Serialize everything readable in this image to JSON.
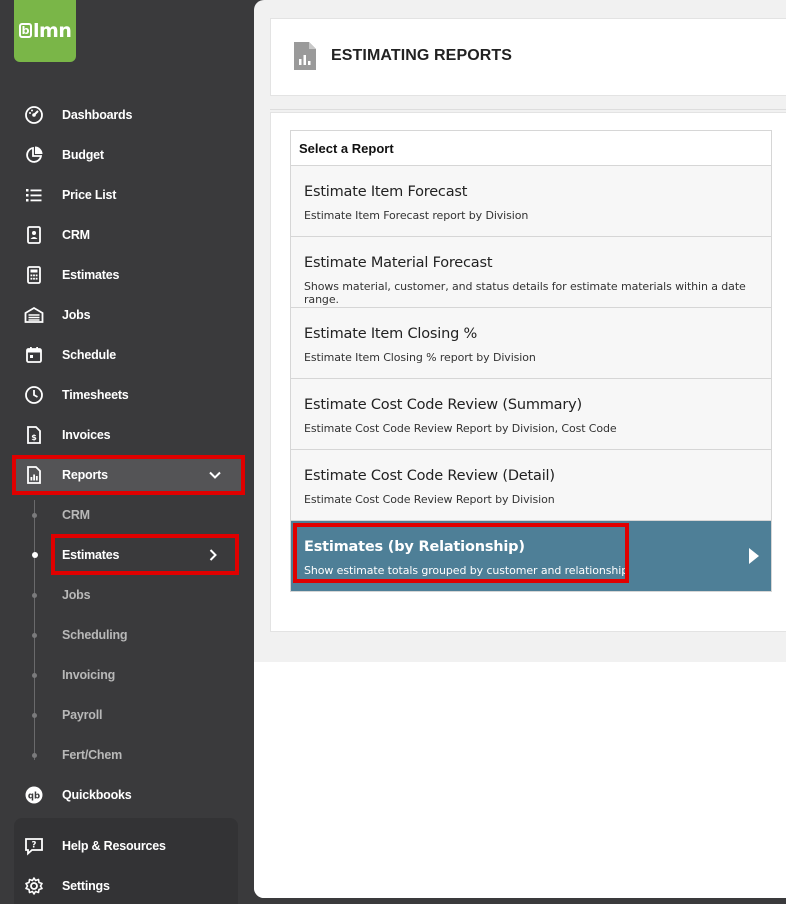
{
  "app": {
    "logo_text": "lmn",
    "logo_letter": "b"
  },
  "colors": {
    "brand": "#7ab648",
    "sidebar": "#3a3a3c",
    "active_row": "#4e7f97",
    "highlight": "#e00000"
  },
  "sidebar": {
    "items": [
      {
        "label": "Dashboards",
        "icon": "dashboard-icon"
      },
      {
        "label": "Budget",
        "icon": "pie-chart-icon"
      },
      {
        "label": "Price List",
        "icon": "list-icon"
      },
      {
        "label": "CRM",
        "icon": "contact-card-icon"
      },
      {
        "label": "Estimates",
        "icon": "calculator-icon"
      },
      {
        "label": "Jobs",
        "icon": "garage-icon"
      },
      {
        "label": "Schedule",
        "icon": "calendar-icon"
      },
      {
        "label": "Timesheets",
        "icon": "clock-icon"
      },
      {
        "label": "Invoices",
        "icon": "invoice-icon"
      },
      {
        "label": "Reports",
        "icon": "report-icon"
      }
    ],
    "reports_submenu": [
      {
        "label": "CRM"
      },
      {
        "label": "Estimates"
      },
      {
        "label": "Jobs"
      },
      {
        "label": "Scheduling"
      },
      {
        "label": "Invoicing"
      },
      {
        "label": "Payroll"
      },
      {
        "label": "Fert/Chem"
      }
    ],
    "quickbooks": {
      "label": "Quickbooks",
      "icon": "quickbooks-icon"
    },
    "help": {
      "label": "Help & Resources",
      "icon": "help-icon"
    },
    "settings": {
      "label": "Settings",
      "icon": "gear-icon"
    }
  },
  "page": {
    "title": "ESTIMATING REPORTS",
    "select_header": "Select a Report",
    "reports": [
      {
        "title": "Estimate Item Forecast",
        "desc": "Estimate Item Forecast report by Division"
      },
      {
        "title": "Estimate Material Forecast",
        "desc": "Shows material, customer, and status details for estimate materials within a date range."
      },
      {
        "title": "Estimate Item Closing %",
        "desc": "Estimate Item Closing % report by Division"
      },
      {
        "title": "Estimate Cost Code Review (Summary)",
        "desc": "Estimate Cost Code Review Report by Division, Cost Code"
      },
      {
        "title": "Estimate Cost Code Review (Detail)",
        "desc": "Estimate Cost Code Review Report by Division"
      },
      {
        "title": "Estimates (by Relationship)",
        "desc": "Show estimate totals grouped by customer and relationship",
        "selected": true
      }
    ]
  }
}
